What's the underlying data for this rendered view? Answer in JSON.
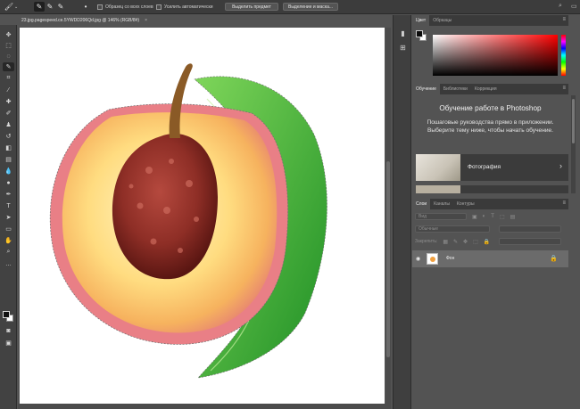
{
  "options_bar": {
    "sample_all_layers": "Образец со всех слоев",
    "auto_enhance": "Усилить автоматически",
    "select_subject": "Выделить предмет",
    "select_and_mask": "Выделение и маска...",
    "brush_size_caret": "⌄"
  },
  "document": {
    "tab_title": "23.jpg.pagespeed.ce.5YWDD206Qd.jpg @ 146% (RGB/8#)",
    "close_glyph": "×"
  },
  "panels": {
    "color": {
      "tab_color": "Цвет",
      "tab_swatches": "Образцы"
    },
    "learn": {
      "tab_learn": "Обучение",
      "tab_libraries": "Библиотеки",
      "tab_adjustments": "Коррекция",
      "title": "Обучение работе в Photoshop",
      "subtitle": "Пошаговые руководства прямо в приложении. Выберите тему ниже, чтобы начать обучение.",
      "card_label": "Фотография",
      "card_arrow": "›"
    },
    "layers": {
      "tab_layers": "Слои",
      "tab_channels": "Каналы",
      "tab_paths": "Контуры",
      "filter_kind": "Вид",
      "blend_mode": "Обычные",
      "lock_label": "Закрепить:",
      "layer_name": "Фон"
    },
    "menu_glyph": "≡"
  },
  "colors": {
    "app_bg": "#535353",
    "panel_dark": "#3c3c3c",
    "selected_layer": "#6b6b6b",
    "foreground": "#0b0b0b",
    "background": "#ffffff"
  }
}
